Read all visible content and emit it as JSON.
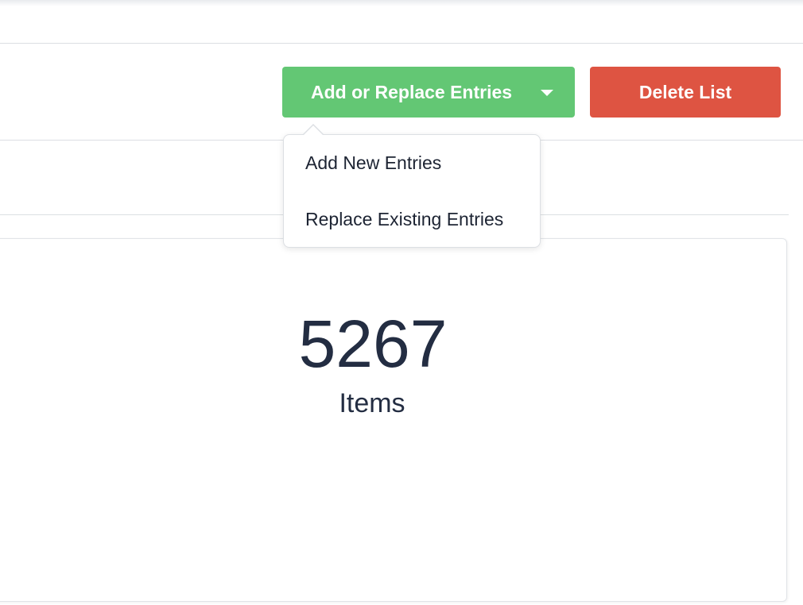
{
  "toolbar": {
    "add_replace_label": "Add or Replace Entries",
    "delete_label": "Delete List"
  },
  "dropdown": {
    "items": [
      {
        "label": "Add New Entries"
      },
      {
        "label": "Replace Existing Entries"
      }
    ]
  },
  "summary": {
    "count": "5267",
    "count_label": "Items"
  },
  "colors": {
    "add_button": "#63c774",
    "delete_button": "#de5442",
    "text": "#232d42"
  },
  "icons": {
    "dropdown_caret": "caret-down-icon"
  }
}
